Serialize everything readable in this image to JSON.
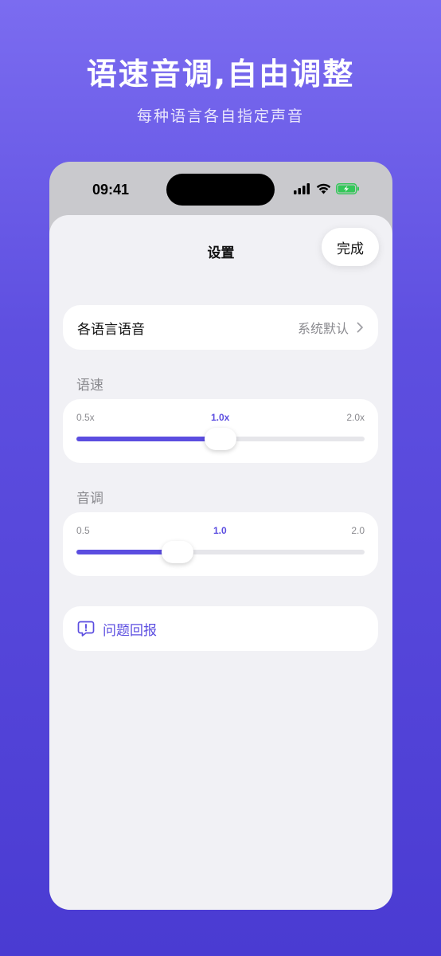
{
  "promo": {
    "title": "语速音调,自由调整",
    "subtitle": "每种语言各自指定声音"
  },
  "status_bar": {
    "time": "09:41"
  },
  "sheet": {
    "title": "设置",
    "done_label": "完成"
  },
  "language_voice": {
    "label": "各语言语音",
    "value": "系统默认"
  },
  "speed": {
    "section_label": "语速",
    "min_label": "0.5x",
    "current_label": "1.0x",
    "max_label": "2.0x",
    "fill_fraction": 0.5
  },
  "pitch": {
    "section_label": "音调",
    "min_label": "0.5",
    "current_label": "1.0",
    "max_label": "2.0",
    "fill_fraction": 0.35
  },
  "feedback": {
    "label": "问题回报"
  },
  "colors": {
    "accent": "#5b4de0",
    "background_top": "#7b6cf0",
    "background_bottom": "#4a3bd2"
  }
}
